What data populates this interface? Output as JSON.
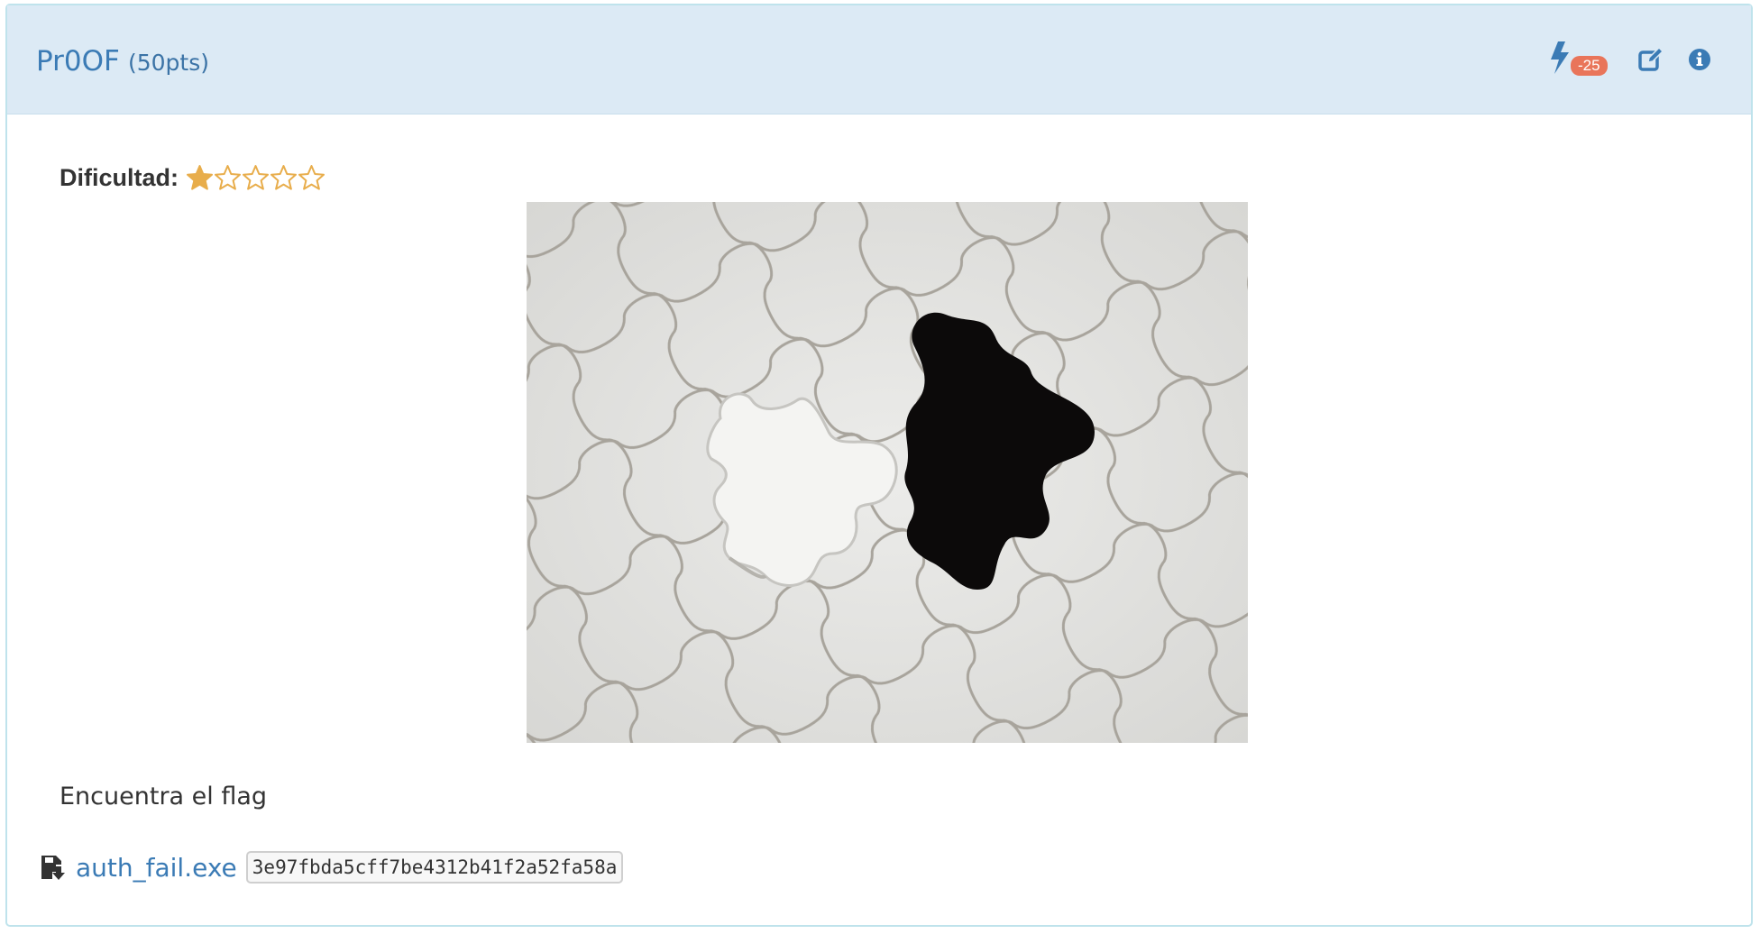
{
  "challenge": {
    "name": "Pr0OF",
    "points": "(50pts)"
  },
  "header_actions": {
    "first_blood_icon": "bolt-icon",
    "first_blood_badge": "-25",
    "edit_icon": "edit-icon",
    "info_icon": "info-circle-icon",
    "badge_color": "#e9755a",
    "icon_color": "#3b7bb5"
  },
  "difficulty": {
    "label": "Dificultad:",
    "rating": 1,
    "max": 5,
    "star_color": "#e8ad4b"
  },
  "image": {
    "icon": "puzzle-image"
  },
  "description": "Encuentra el flag",
  "attachment": {
    "icon": "file-download-icon",
    "filename": "auth_fail.exe",
    "hash": "3e97fbda5cff7be4312b41f2a52fa58a"
  },
  "colors": {
    "header_bg": "#dceaf5",
    "border": "#bfe3ec",
    "link": "#3b7bb5"
  }
}
